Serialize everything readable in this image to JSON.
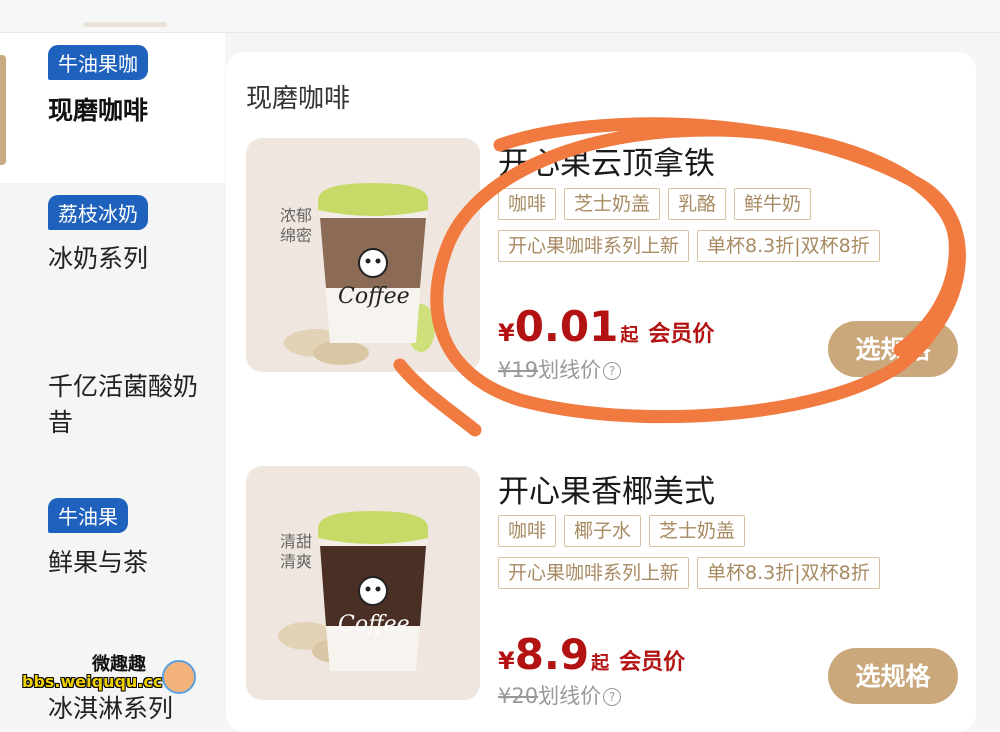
{
  "sidebar": {
    "items": [
      {
        "badge": "牛油果咖",
        "label": "现磨咖啡"
      },
      {
        "badge": "荔枝冰奶",
        "label": "冰奶系列"
      },
      {
        "badge": "",
        "label": "千亿活菌酸奶昔"
      },
      {
        "badge": "牛油果",
        "label": "鲜果与茶"
      },
      {
        "badge": "",
        "label": "冰淇淋系列"
      }
    ]
  },
  "section": {
    "title": "现磨咖啡"
  },
  "products": [
    {
      "name": "开心果云顶拿铁",
      "tags_row1": [
        "咖啡",
        "芝士奶盖",
        "乳酪",
        "鲜牛奶"
      ],
      "tags_row2": [
        "开心果咖啡系列上新",
        "单杯8.3折|双杯8折"
      ],
      "currency": "¥",
      "price": "0.01",
      "price_suffix": "起",
      "member_label": "会员价",
      "orig_price": "¥19",
      "orig_label": "划线价",
      "help_icon": "?",
      "button": "选规格",
      "cup_text": "浓郁绵密",
      "cup_brand": "Coffee"
    },
    {
      "name": "开心果香椰美式",
      "tags_row1": [
        "咖啡",
        "椰子水",
        "芝士奶盖"
      ],
      "tags_row2": [
        "开心果咖啡系列上新",
        "单杯8.3折|双杯8折"
      ],
      "currency": "¥",
      "price": "8.9",
      "price_suffix": "起",
      "member_label": "会员价",
      "orig_price": "¥20",
      "orig_label": "划线价",
      "help_icon": "?",
      "button": "选规格",
      "cup_text": "清甜清爽",
      "cup_brand": "Coffee"
    }
  ],
  "watermark": {
    "line1": "微趣趣",
    "line2": "bbs.weiququ.cc"
  },
  "colors": {
    "accent": "#caa87b",
    "price": "#b31212",
    "badge": "#1f62bd",
    "circle": "#f07a3f"
  }
}
